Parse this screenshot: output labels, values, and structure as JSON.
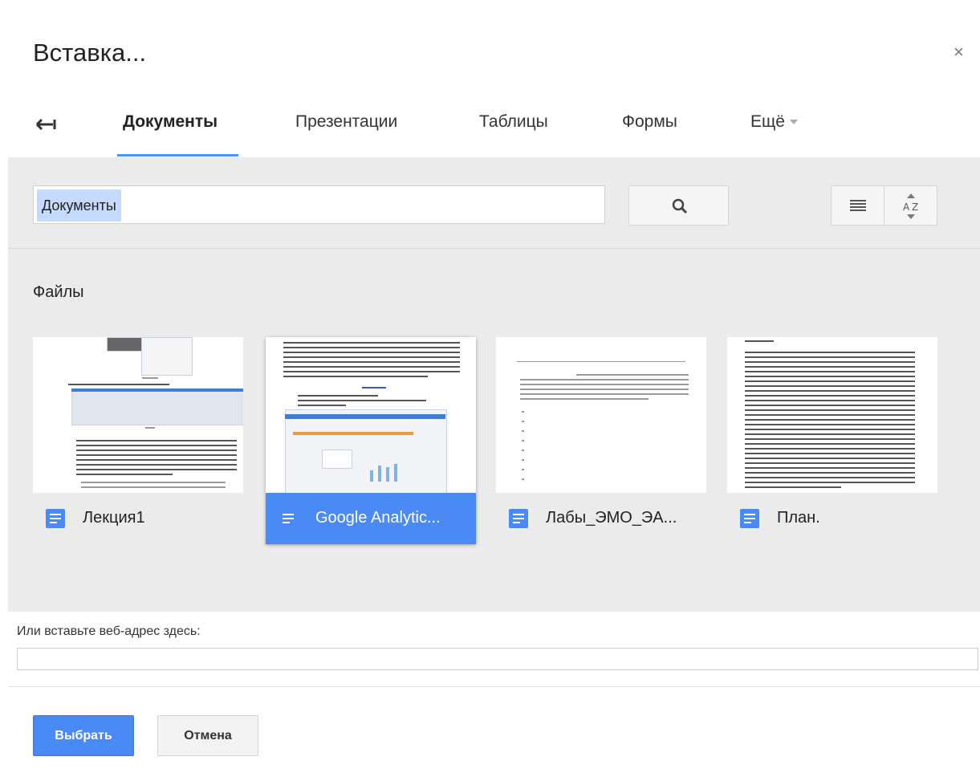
{
  "dialog": {
    "title": "Вставка...",
    "close_label": "×"
  },
  "tabs": [
    {
      "label": "Документы",
      "active": true
    },
    {
      "label": "Презентации",
      "active": false
    },
    {
      "label": "Таблицы",
      "active": false
    },
    {
      "label": "Формы",
      "active": false
    },
    {
      "label": "Ещё",
      "active": false
    }
  ],
  "search": {
    "chip": "Документы"
  },
  "section_label": "Файлы",
  "files": [
    {
      "name": "Лекция1",
      "selected": false
    },
    {
      "name": "Google Analytic...",
      "selected": true
    },
    {
      "name": "Лабы_ЭМО_ЭА...",
      "selected": false
    },
    {
      "name": "План.",
      "selected": false
    }
  ],
  "url": {
    "label": "Или вставьте веб-адрес здесь:",
    "value": ""
  },
  "buttons": {
    "select": "Выбрать",
    "cancel": "Отмена"
  },
  "colors": {
    "accent": "#4a8af4",
    "grey_area": "#ebebeb",
    "chip": "#c6dafc"
  },
  "icons": [
    "back-arrow-icon",
    "search-icon",
    "list-view-icon",
    "sort-az-icon",
    "document-icon",
    "close-icon"
  ]
}
